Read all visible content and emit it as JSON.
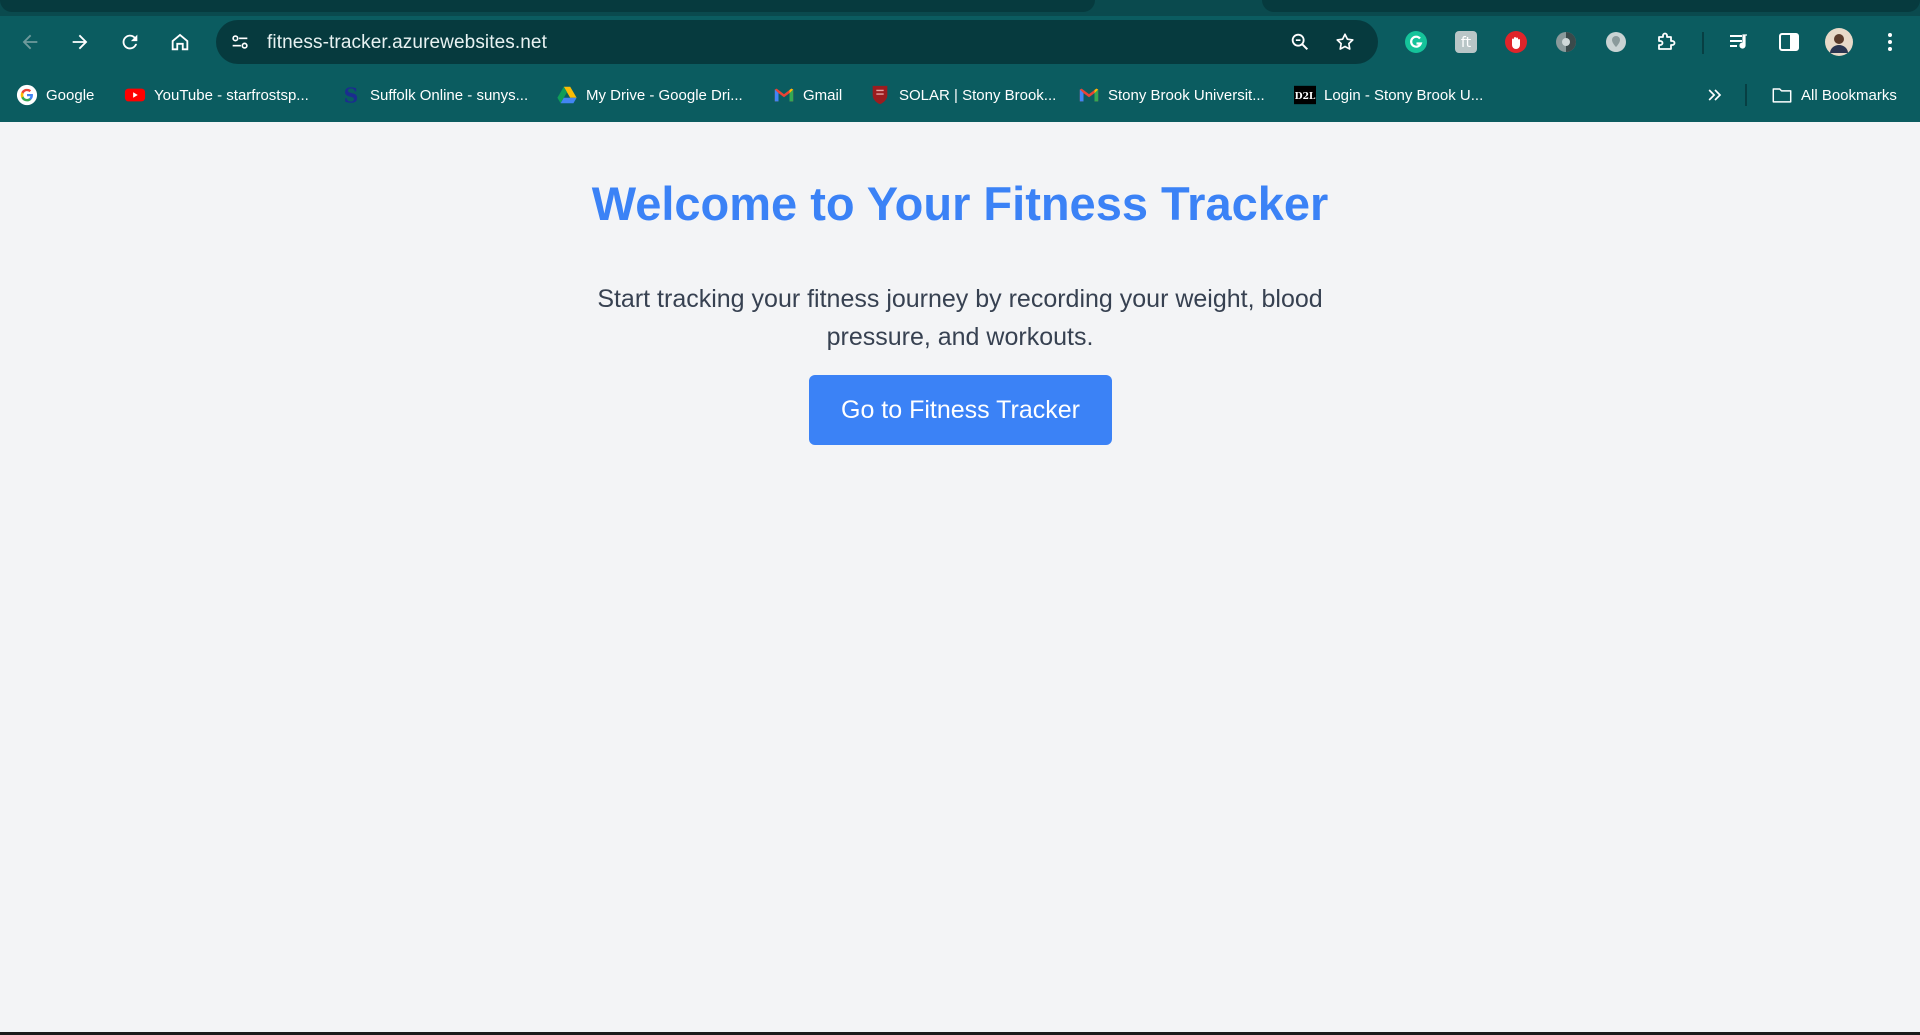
{
  "browser": {
    "url": "fitness-tracker.azurewebsites.net",
    "bookmarks": [
      {
        "label": "Google",
        "icon": "google-icon"
      },
      {
        "label": "YouTube - starfrostsp...",
        "icon": "youtube-icon"
      },
      {
        "label": "Suffolk Online - sunys...",
        "icon": "suffolk-icon"
      },
      {
        "label": "My Drive - Google Dri...",
        "icon": "google-drive-icon"
      },
      {
        "label": "Gmail",
        "icon": "gmail-icon"
      },
      {
        "label": "SOLAR | Stony Brook...",
        "icon": "stony-brook-shield-icon"
      },
      {
        "label": "Stony Brook Universit...",
        "icon": "gmail-icon"
      },
      {
        "label": "Login - Stony Brook U...",
        "icon": "d2l-icon"
      }
    ],
    "d2l_text": "D2L",
    "all_bookmarks": "All Bookmarks"
  },
  "page": {
    "title": "Welcome to Your Fitness Tracker",
    "intro": "Start tracking your fitness journey by recording your weight, blood pressure, and workouts.",
    "cta_label": "Go to Fitness Tracker"
  },
  "colors": {
    "chrome_bg": "#0b5c60",
    "omnibox_bg": "#063a3e",
    "accent": "#3b82f6",
    "page_bg": "#f3f4f6",
    "body_text": "#374151"
  }
}
